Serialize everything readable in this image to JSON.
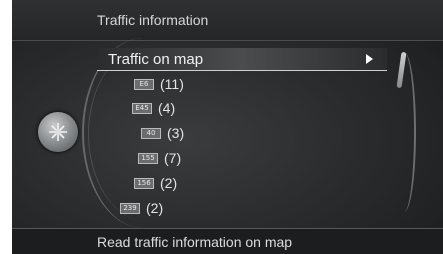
{
  "header": {
    "title": "Traffic information"
  },
  "menu": {
    "selected_label": "Traffic on map",
    "items": [
      {
        "road": "E6",
        "count": "(11)"
      },
      {
        "road": "E45",
        "count": "(4)"
      },
      {
        "road": "40",
        "count": "(3)"
      },
      {
        "road": "155",
        "count": "(7)"
      },
      {
        "road": "156",
        "count": "(2)"
      },
      {
        "road": "239",
        "count": "(2)"
      }
    ]
  },
  "footer": {
    "hint": "Read traffic information on map"
  },
  "icons": {
    "knob": "rotary-knob-icon",
    "arrow": "right-arrow-icon"
  },
  "colors": {
    "background": "#2a2c2e",
    "text": "#e4e4e4",
    "accent": "#ffffff"
  }
}
